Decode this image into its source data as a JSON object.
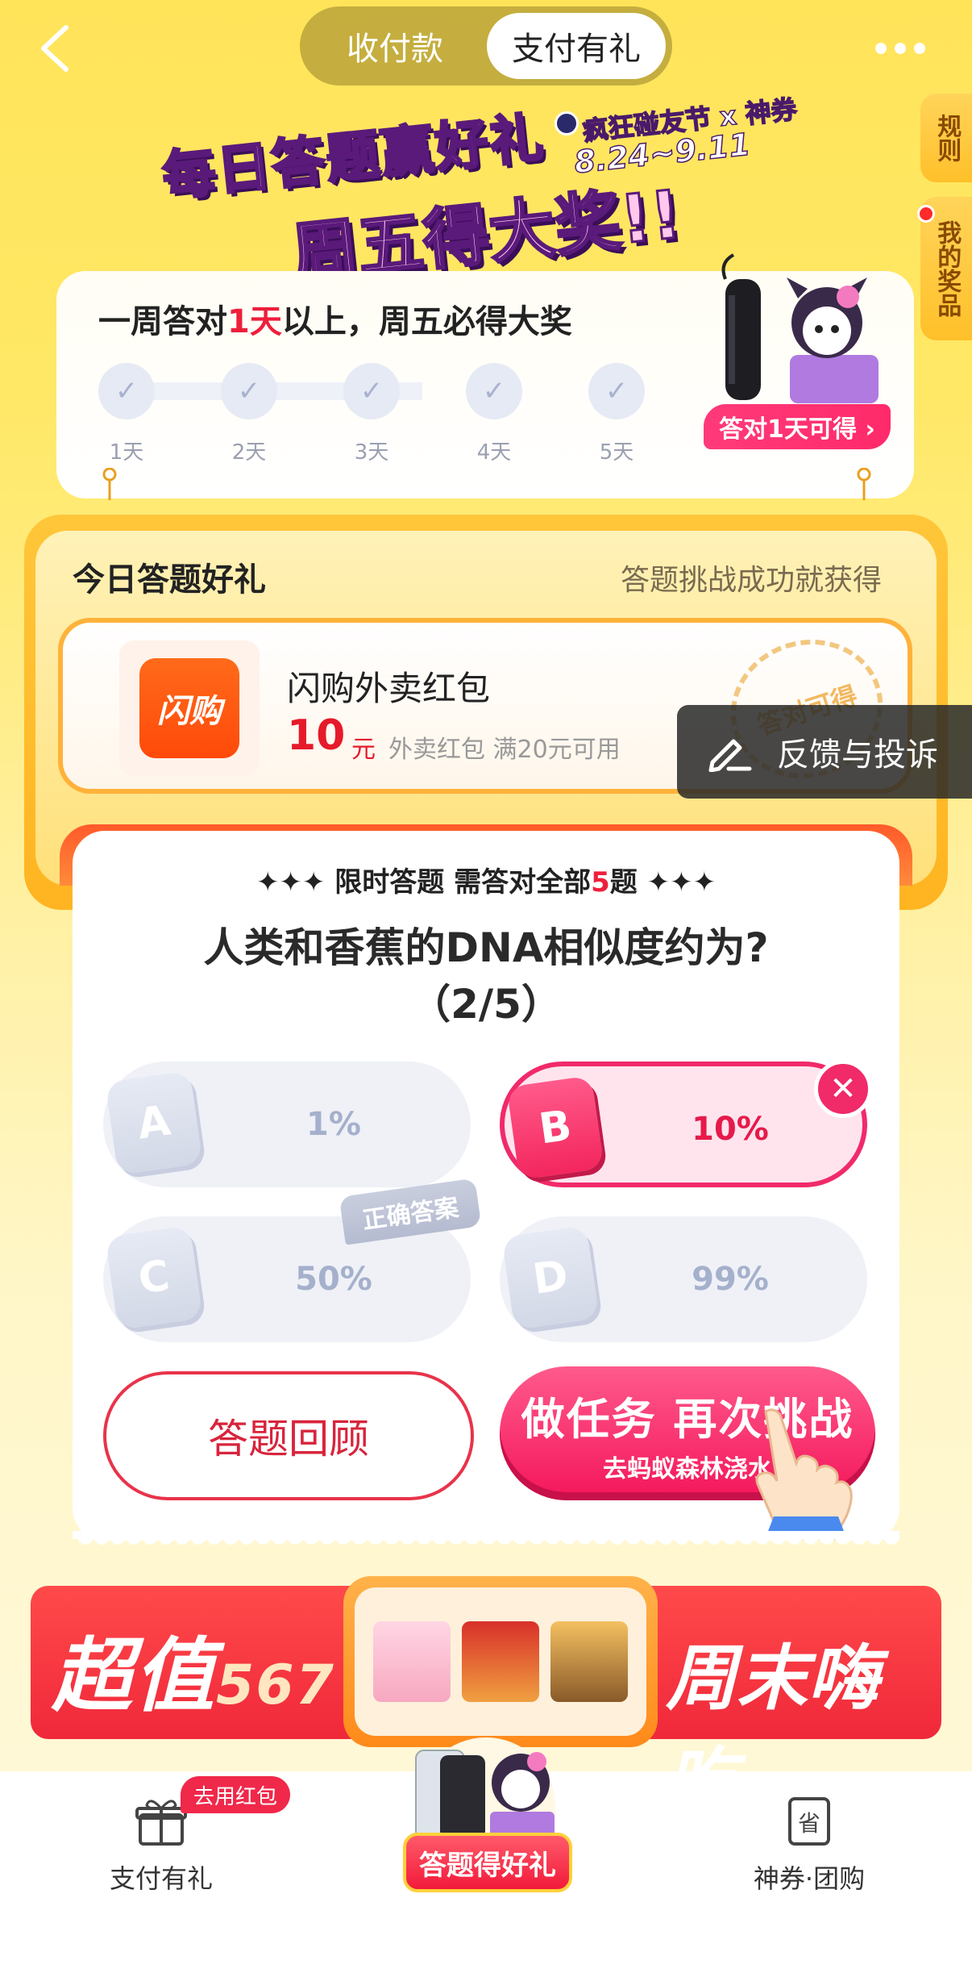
{
  "header": {
    "tabs": [
      "收付款",
      "支付有礼"
    ],
    "active_tab": "支付有礼"
  },
  "side": {
    "rules": "规则",
    "prizes": "我的奖品"
  },
  "banner": {
    "line1": "每日答题赢好礼",
    "line2": "周五得大奖!!",
    "festival": "疯狂碰友节 x 神券",
    "dates": "8.24~9.11"
  },
  "week": {
    "title_prefix": "一周答对",
    "title_highlight": "1天",
    "title_suffix": "以上，周五必得大奖",
    "days": [
      "1天",
      "2天",
      "3天",
      "4天",
      "5天"
    ],
    "prize_tag": "答对1天可得 ›"
  },
  "gift": {
    "heading": "今日答题好礼",
    "subtitle": "答题挑战成功就获得",
    "logo_text": "闪购",
    "name": "闪购外卖红包",
    "amount": "10",
    "unit": "元",
    "desc": "外卖红包 满20元可用",
    "stamp": "答对可得"
  },
  "feedback": {
    "label": "反馈与投诉"
  },
  "quiz": {
    "head_prefix": "✦✦✦ 限时答题 需答对全部",
    "head_count": "5",
    "head_suffix": "题 ✦✦✦",
    "question": "人类和香蕉的DNA相似度约为?",
    "progress": "（2/5）",
    "options": [
      {
        "letter": "A",
        "value": "1%"
      },
      {
        "letter": "B",
        "value": "10%"
      },
      {
        "letter": "C",
        "value": "50%"
      },
      {
        "letter": "D",
        "value": "99%"
      }
    ],
    "selected_wrong": "B",
    "correct_label": "正确答案",
    "review_button": "答题回顾",
    "retry_button": "做任务 再次挑战",
    "retry_sub": "去蚂蚁森林浇水"
  },
  "promo": {
    "left": "超值",
    "left_num": "567",
    "right": "周末嗨吃"
  },
  "tabbar": {
    "left_label": "支付有礼",
    "left_badge": "去用红包",
    "center_label": "答题得好礼",
    "right_label": "神券·团购",
    "right_icon_char": "省"
  },
  "colors": {
    "accent_red": "#ee1f3c",
    "accent_pink": "#f12a6a",
    "banner_yellow": "#ffe45a"
  }
}
